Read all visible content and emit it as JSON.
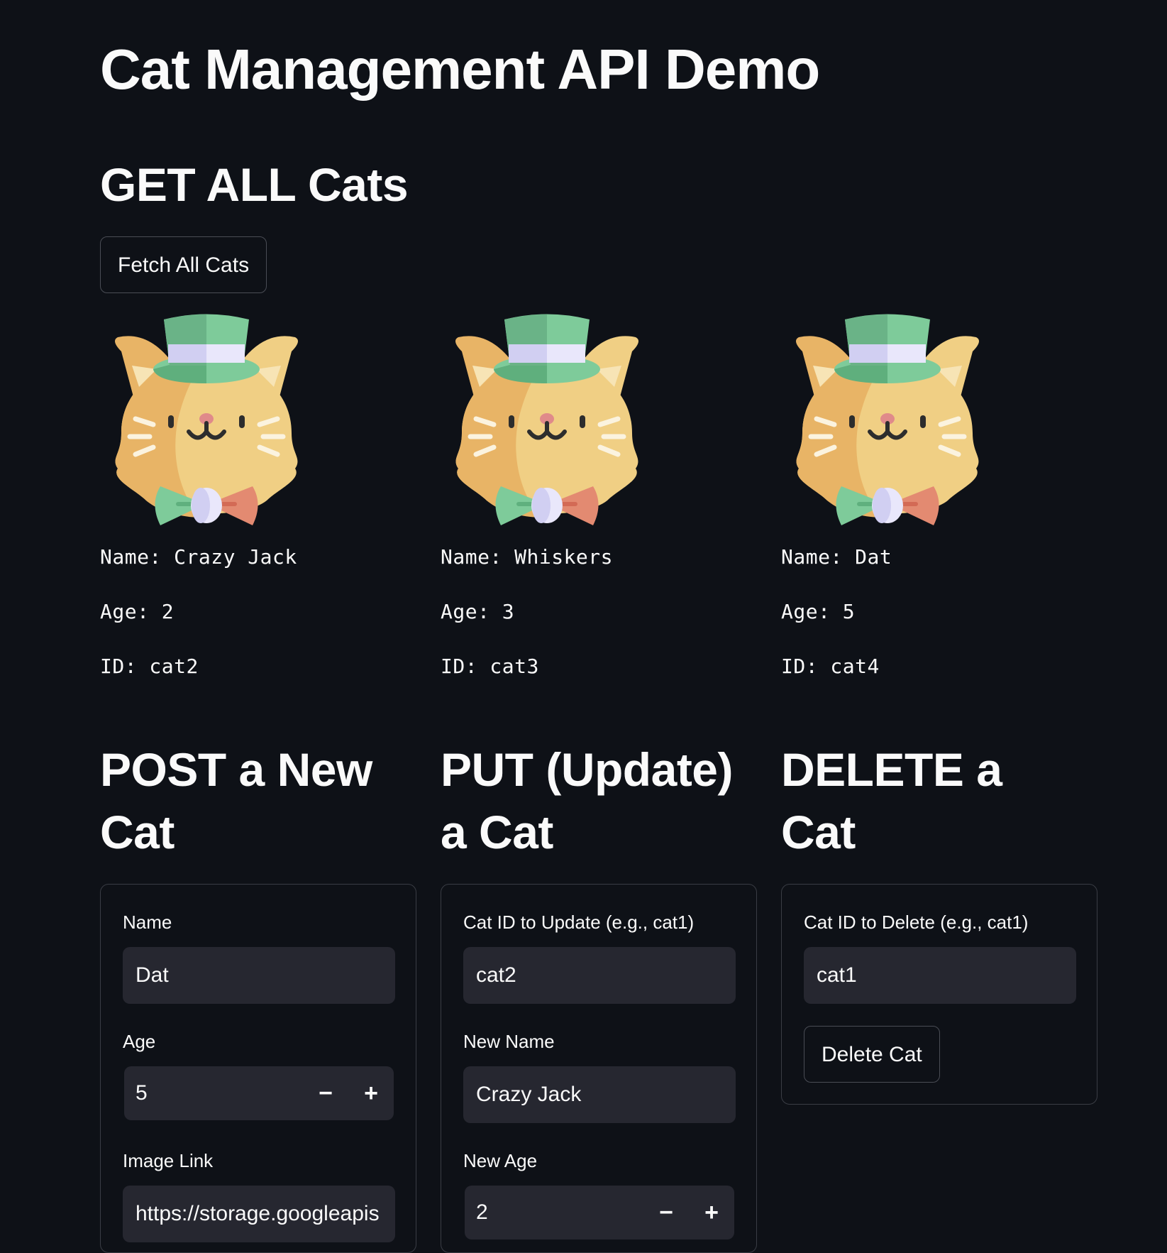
{
  "app": {
    "title": "Cat Management API Demo"
  },
  "get_section": {
    "title": "GET ALL Cats",
    "fetch_button": "Fetch All Cats",
    "cats": [
      {
        "name_line": "Name: Crazy Jack",
        "age_line": "Age: 2",
        "id_line": "ID: cat2"
      },
      {
        "name_line": "Name: Whiskers",
        "age_line": "Age: 3",
        "id_line": "ID: cat3"
      },
      {
        "name_line": "Name: Dat",
        "age_line": "Age: 5",
        "id_line": "ID: cat4"
      }
    ]
  },
  "post_section": {
    "title_line1": "POST a New",
    "title_line2": "Cat",
    "name_label": "Name",
    "name_value": "Dat",
    "age_label": "Age",
    "age_value": "5",
    "image_label": "Image Link",
    "image_value": "https://storage.googleapis"
  },
  "put_section": {
    "title_line1": "PUT (Update)",
    "title_line2": "a Cat",
    "id_label": "Cat ID to Update (e.g., cat1)",
    "id_value": "cat2",
    "new_name_label": "New Name",
    "new_name_value": "Crazy Jack",
    "new_age_label": "New Age",
    "new_age_value": "2"
  },
  "delete_section": {
    "title_line1": "DELETE a",
    "title_line2": "Cat",
    "id_label": "Cat ID to Delete (e.g., cat1)",
    "id_value": "cat1",
    "delete_button": "Delete Cat"
  },
  "stepper": {
    "minus": "−",
    "plus": "+"
  },
  "icons": {
    "cat_image": "cat-with-top-hat-icon"
  },
  "colors": {
    "background": "#0e1117",
    "input_bg": "#262730",
    "text": "#fafafa",
    "border": "#3a3d45"
  }
}
